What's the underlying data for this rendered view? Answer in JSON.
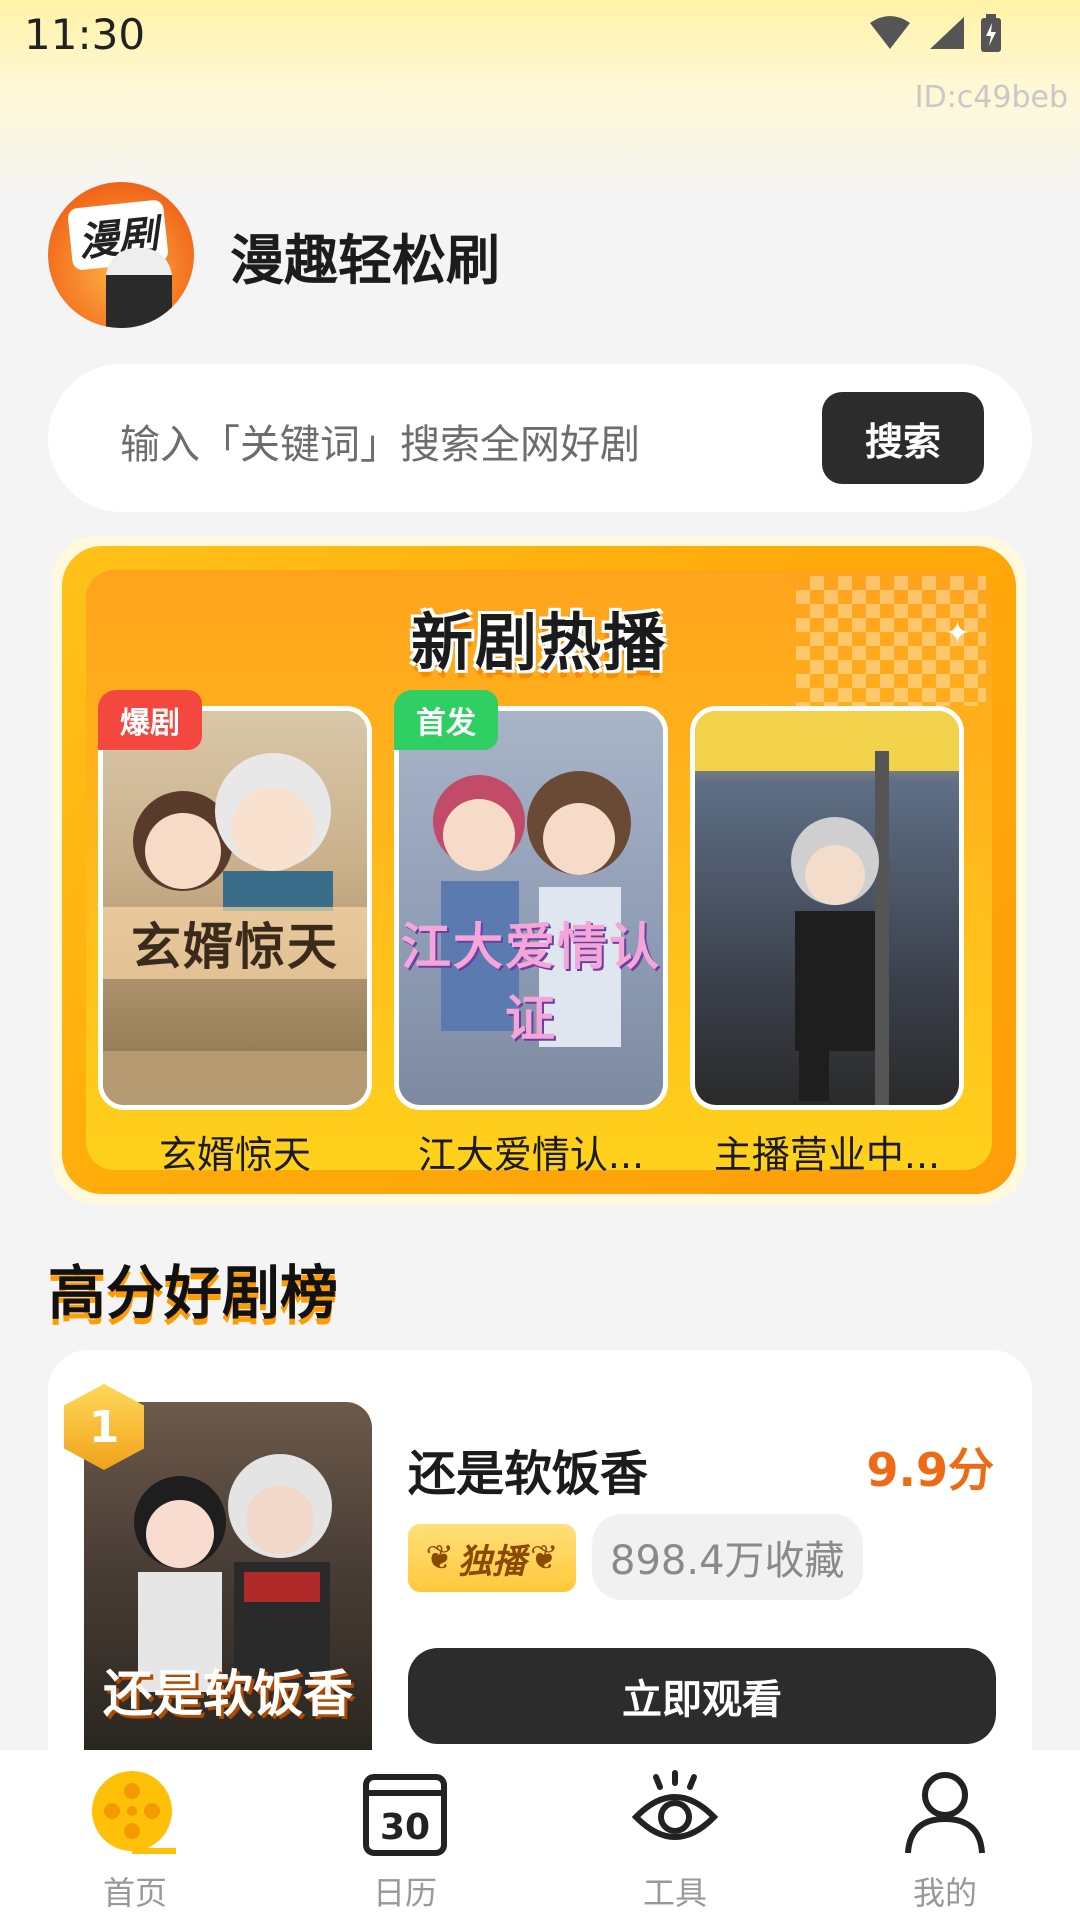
{
  "status_bar": {
    "time": "11:30",
    "device_id": "ID:c49beb"
  },
  "header": {
    "logo_text": "漫剧",
    "app_title": "漫趣轻松刷"
  },
  "search": {
    "placeholder": "输入「关键词」搜索全网好剧",
    "button_label": "搜索"
  },
  "hot_section": {
    "title": "新剧热播",
    "items": [
      {
        "badge": "爆剧",
        "badge_color": "#f4473f",
        "poster_text": "玄婿惊天",
        "caption": "玄婿惊天"
      },
      {
        "badge": "首发",
        "badge_color": "#2fcf63",
        "poster_text": "江大爱情认证",
        "caption": "江大爱情认..."
      },
      {
        "badge": "",
        "badge_color": "",
        "poster_text": "",
        "caption": "主播营业中..."
      }
    ]
  },
  "ranking": {
    "title": "高分好剧榜",
    "first": {
      "rank": "1",
      "poster_text": "还是软饭香",
      "name": "还是软饭香",
      "score": "9.9分",
      "exclusive_tag": "独播",
      "favorites": "898.4万收藏",
      "watch_button": "立即观看"
    }
  },
  "bottom_nav": {
    "items": [
      {
        "label": "首页",
        "icon": "home-film-reel-icon",
        "active": true
      },
      {
        "label": "日历",
        "icon": "calendar-30-icon",
        "active": false
      },
      {
        "label": "工具",
        "icon": "eye-icon",
        "active": false
      },
      {
        "label": "我的",
        "icon": "person-icon",
        "active": false
      }
    ]
  },
  "colors": {
    "accent_orange": "#ee6a14",
    "hot_yellow": "#ffc21a",
    "dark_button": "#2c2c2c",
    "home_icon": "#ffc107"
  }
}
